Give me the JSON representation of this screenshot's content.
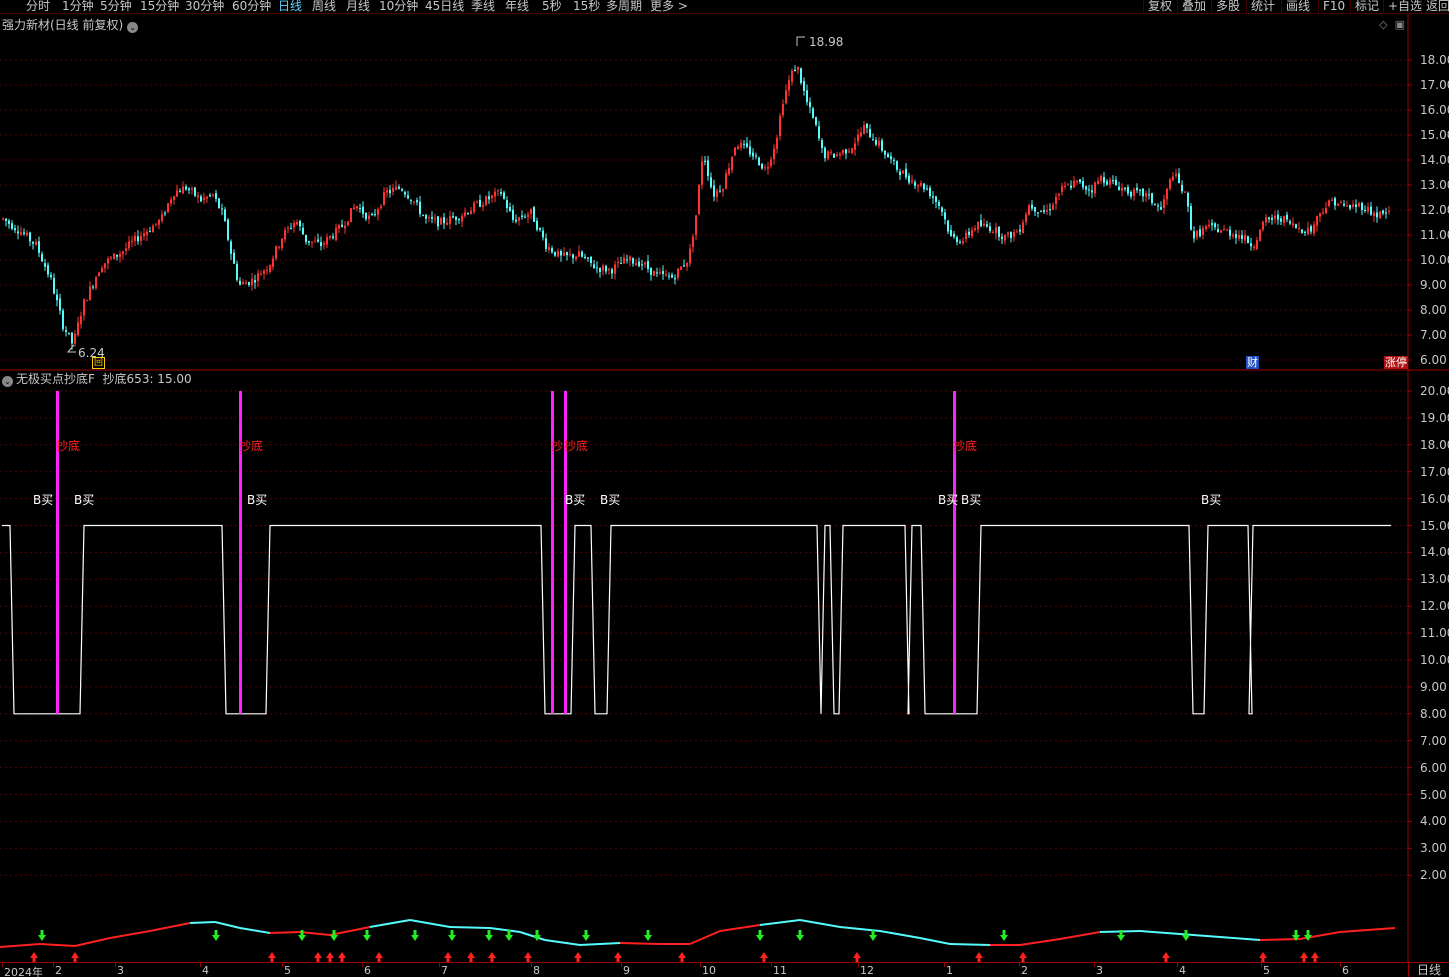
{
  "toolbar": {
    "periods": [
      "分时",
      "1分钟",
      "5分钟",
      "15分钟",
      "30分钟",
      "60分钟",
      "日线",
      "周线",
      "月线",
      "10分钟",
      "45日线",
      "季线",
      "年线",
      "5秒",
      "15秒",
      "多周期",
      "更多 >"
    ],
    "active_period": "日线",
    "right_buttons": [
      "复权",
      "叠加",
      "多股",
      "统计",
      "画线",
      "F10",
      "标记",
      "+自选",
      "返回"
    ]
  },
  "main_chart": {
    "title": "强力新材(日线 前复权)",
    "high_label": "18.98",
    "low_label": "6.24",
    "y_ticks": [
      "18.00",
      "17.00",
      "16.00",
      "15.00",
      "14.00",
      "13.00",
      "12.00",
      "11.00",
      "10.00",
      "9.00",
      "8.00",
      "7.00",
      "6.00"
    ],
    "badge_finance": "财",
    "badge_limit": "涨停",
    "marker_box": "回",
    "colors": {
      "up": "#ff3232",
      "down": "#54fcfc"
    }
  },
  "indicator": {
    "title": "无极买点抄底F",
    "value_label": "抄底653: 15.00",
    "y_ticks": [
      "20.00",
      "19.00",
      "18.00",
      "17.00",
      "16.00",
      "15.00",
      "14.00",
      "13.00",
      "12.00",
      "11.00",
      "10.00",
      "9.00",
      "8.00",
      "7.00",
      "6.00",
      "5.00",
      "4.00",
      "3.00",
      "2.00"
    ],
    "signal_labels": [
      {
        "text": "抄底",
        "type": "bottom"
      },
      {
        "text": "抄底",
        "type": "bottom"
      },
      {
        "text": "抄",
        "type": "bottom"
      },
      {
        "text": "抄底",
        "type": "bottom"
      },
      {
        "text": "抄底",
        "type": "bottom"
      },
      {
        "text": "B买",
        "type": "buy"
      },
      {
        "text": "B买",
        "type": "buy"
      },
      {
        "text": "B买",
        "type": "buy"
      },
      {
        "text": "B买",
        "type": "buy"
      },
      {
        "text": "B买",
        "type": "buy"
      },
      {
        "text": "B买",
        "type": "buy"
      },
      {
        "text": "B买",
        "type": "buy"
      },
      {
        "text": "B买",
        "type": "buy"
      }
    ],
    "colors": {
      "signal_bar": "#ff22ff",
      "signal_text": "#ff2020",
      "line": "#ffffff"
    }
  },
  "time_axis": {
    "labels": [
      "2024年",
      "2",
      "3",
      "4",
      "5",
      "6",
      "7",
      "8",
      "9",
      "10",
      "11",
      "12",
      "1",
      "2",
      "3",
      "4",
      "5",
      "6"
    ],
    "period_label": "日线"
  }
}
